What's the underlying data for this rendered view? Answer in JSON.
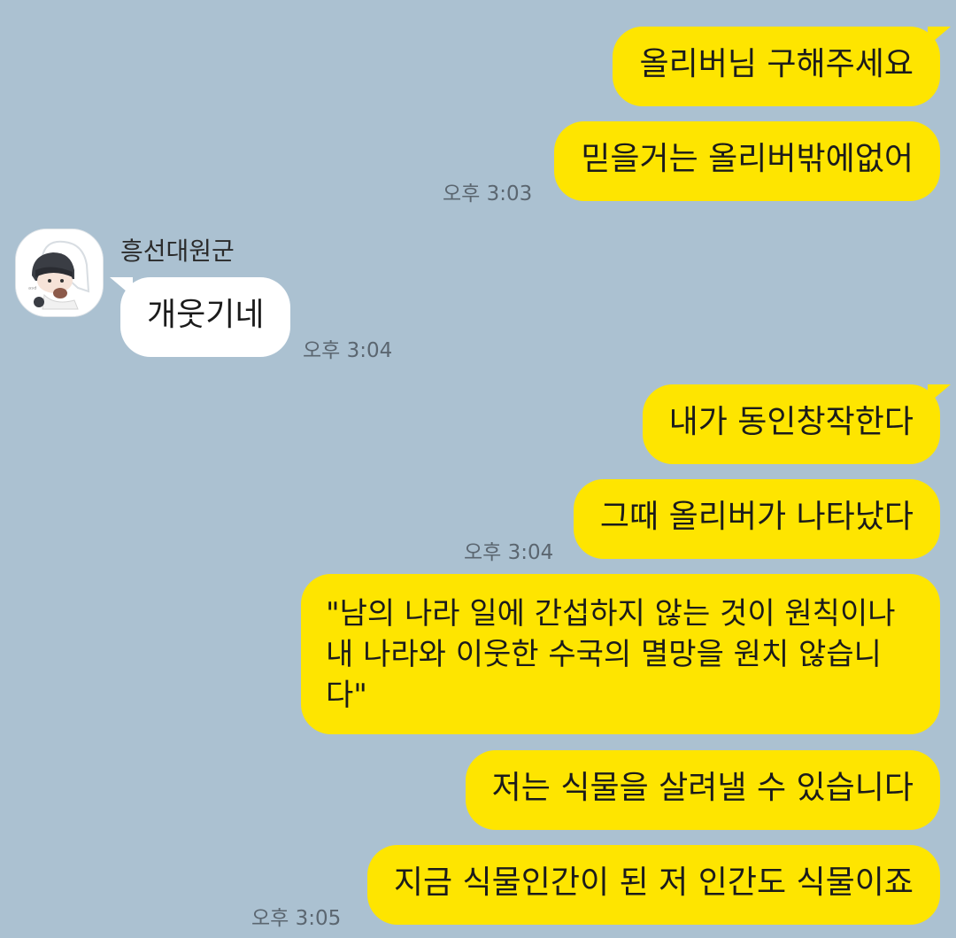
{
  "messages": [
    {
      "text": "올리버님 구해주세요"
    },
    {
      "text": "믿을거는 올리버밖에없어",
      "time": "오후 3:03"
    },
    {
      "text": "개웃기네",
      "time": "오후 3:04"
    },
    {
      "text": "내가 동인창작한다"
    },
    {
      "text": "그때 올리버가 나타났다",
      "time": "오후 3:04"
    },
    {
      "text": "\"남의 나라 일에 간섭하지 않는 것이 원칙이나 내 나라와 이웃한 수국의 멸망을 원치 않습니다\""
    },
    {
      "text": "저는 식물을 살려낼 수 있습니다"
    },
    {
      "text": "지금 식물인간이 된 저 인간도 식물이죠",
      "time": "오후 3:05"
    }
  ],
  "sender": {
    "name": "흥선대원군",
    "avatar_icon": "chibi-character-avatar"
  },
  "colors": {
    "background": "#abc1d1",
    "my_bubble": "#fee500",
    "other_bubble": "#ffffff"
  }
}
